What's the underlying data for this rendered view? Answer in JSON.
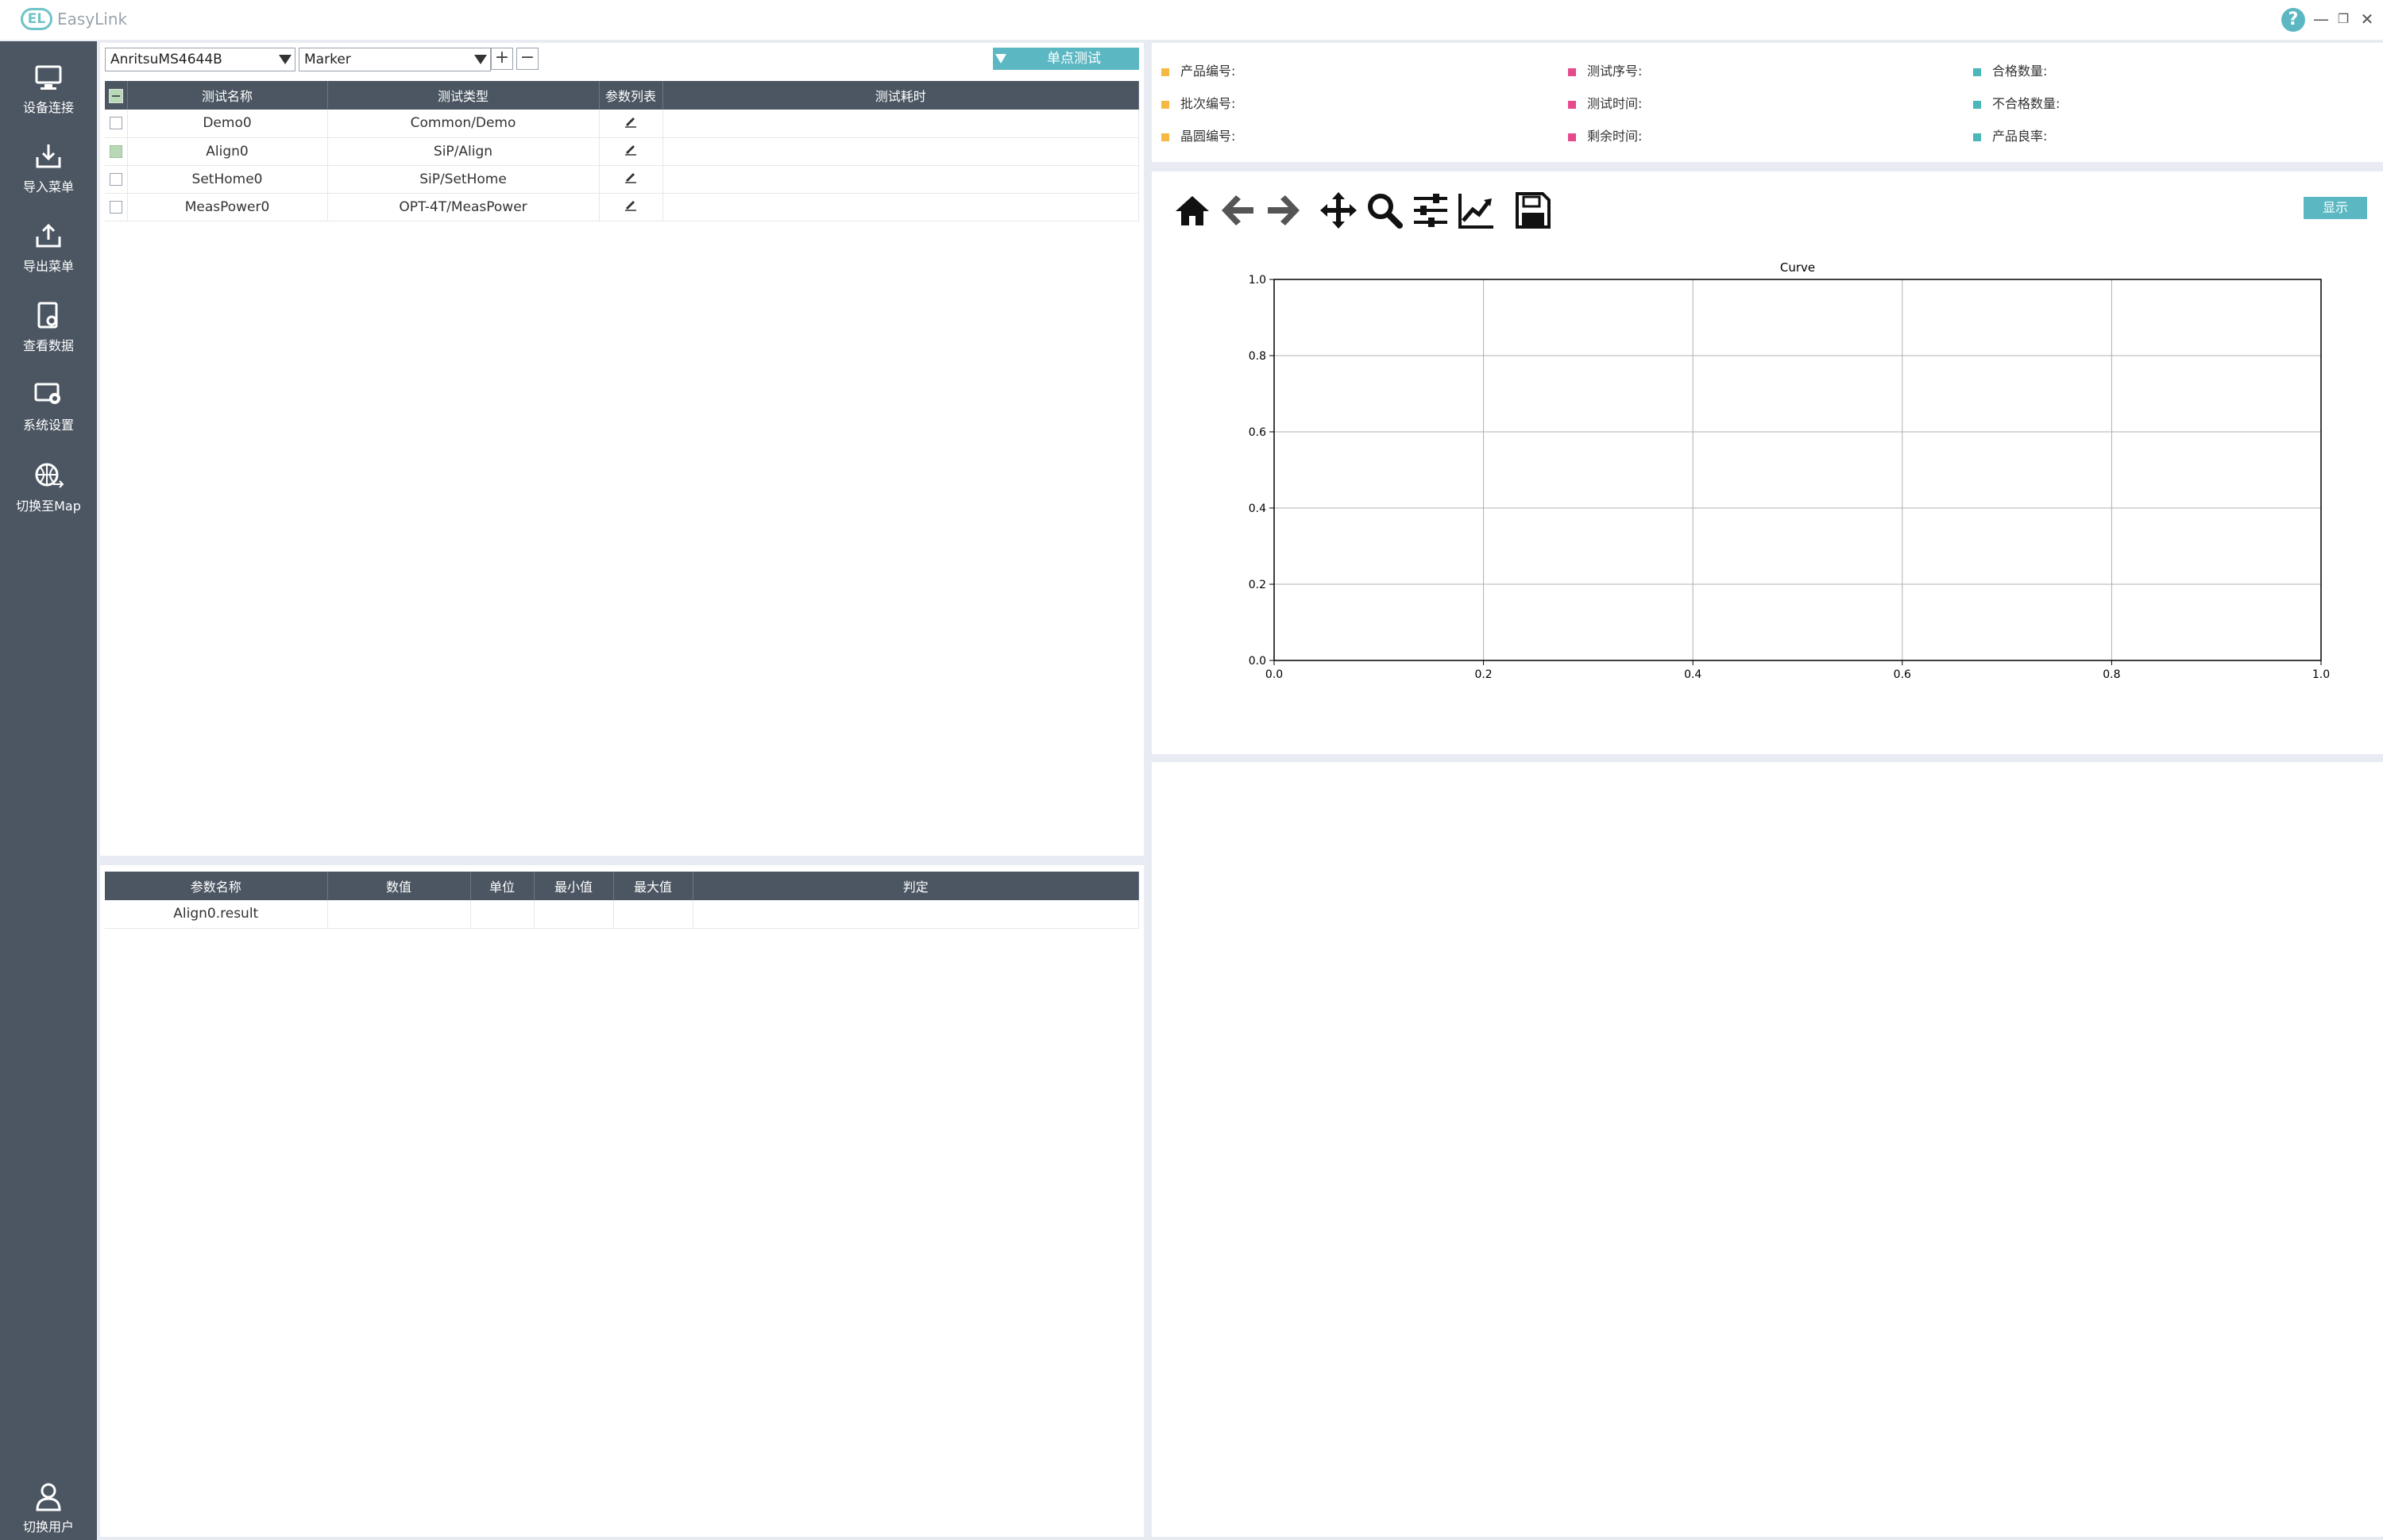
{
  "app": {
    "title": "EasyLink",
    "logo_text": "EL"
  },
  "window": {
    "help": "?",
    "minimize": "—",
    "restore": "❐",
    "close": "✕"
  },
  "sidebar": {
    "items": [
      {
        "label": "设备连接",
        "icon": "monitor-connect-icon"
      },
      {
        "label": "导入菜单",
        "icon": "import-icon"
      },
      {
        "label": "导出菜单",
        "icon": "export-icon"
      },
      {
        "label": "查看数据",
        "icon": "view-data-icon"
      },
      {
        "label": "系统设置",
        "icon": "settings-icon"
      },
      {
        "label": "切换至Map",
        "icon": "globe-switch-icon"
      }
    ],
    "user": {
      "label": "切换用户",
      "icon": "user-icon"
    }
  },
  "toolbar": {
    "device": "AnritsuMS4644B",
    "mode": "Marker",
    "add_label": "+",
    "remove_label": "−",
    "single_test_label": "单点测试"
  },
  "test_table": {
    "headers": [
      "测试名称",
      "测试类型",
      "参数列表",
      "测试耗时"
    ],
    "rows": [
      {
        "name": "Demo0",
        "type": "Common/Demo",
        "checked": false,
        "time": ""
      },
      {
        "name": "Align0",
        "type": "SiP/Align",
        "checked": true,
        "time": ""
      },
      {
        "name": "SetHome0",
        "type": "SiP/SetHome",
        "checked": false,
        "time": ""
      },
      {
        "name": "MeasPower0",
        "type": "OPT-4T/MeasPower",
        "checked": false,
        "time": ""
      }
    ]
  },
  "param_table": {
    "headers": [
      "参数名称",
      "数值",
      "单位",
      "最小值",
      "最大值",
      "判定"
    ],
    "rows": [
      {
        "name": "Align0.result",
        "value": "",
        "unit": "",
        "min": "",
        "max": "",
        "verdict": ""
      }
    ]
  },
  "info": {
    "col1": [
      "产品编号:",
      "批次编号:",
      "晶圆编号:"
    ],
    "col2": [
      "测试序号:",
      "测试时间:",
      "剩余时间:"
    ],
    "col3": [
      "合格数量:",
      "不合格数量:",
      "产品良率:"
    ],
    "colors": {
      "col1": "#f5b942",
      "col2": "#e64a8c",
      "col3": "#4ab8b8"
    }
  },
  "chart_toolbar": {
    "icons": [
      "home-icon",
      "back-icon",
      "forward-icon",
      "pan-icon",
      "zoom-icon",
      "configure-icon",
      "edit-axis-icon",
      "save-icon"
    ],
    "display_label": "显示"
  },
  "chart_data": {
    "type": "line",
    "title": "Curve",
    "xlabel": "",
    "ylabel": "",
    "xlim": [
      0.0,
      1.0
    ],
    "ylim": [
      0.0,
      1.0
    ],
    "xticks": [
      "0.0",
      "0.2",
      "0.4",
      "0.6",
      "0.8",
      "1.0"
    ],
    "yticks": [
      "0.0",
      "0.2",
      "0.4",
      "0.6",
      "0.8",
      "1.0"
    ],
    "grid": true,
    "series": []
  }
}
